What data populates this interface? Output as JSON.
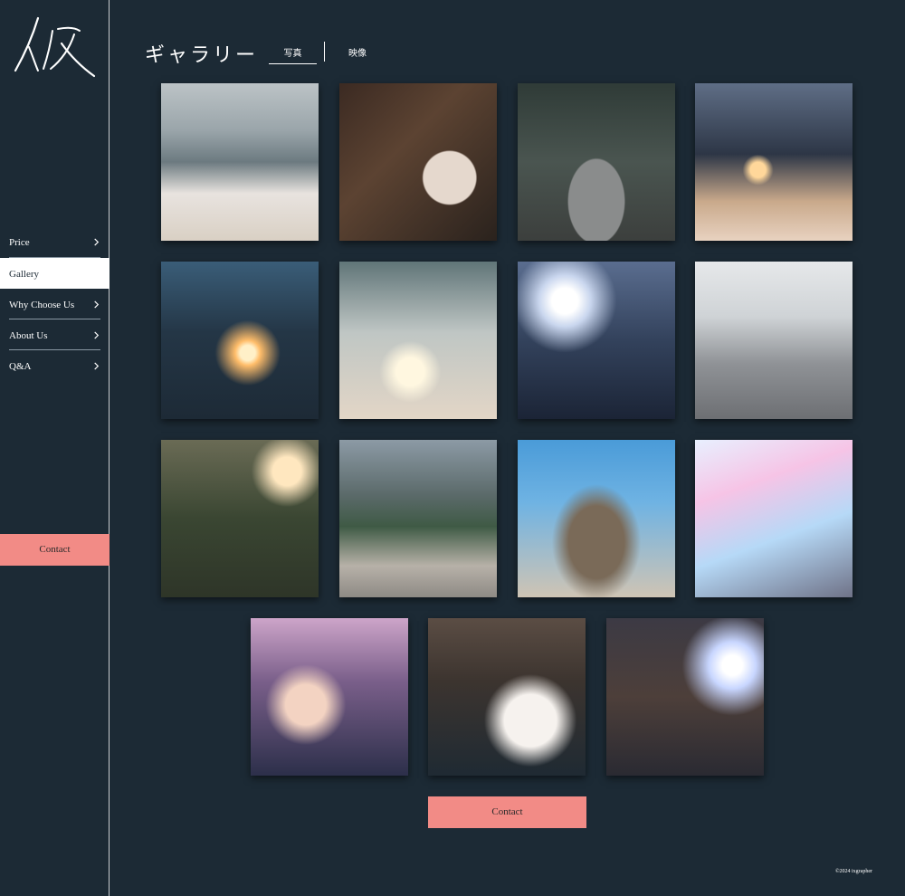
{
  "sidebar": {
    "logo_alt": "ixgrapher",
    "nav": [
      {
        "label": "Price",
        "has_chevron": true
      },
      {
        "label": "Gallery",
        "has_chevron": false,
        "active": true
      },
      {
        "label": "Why Choose Us",
        "has_chevron": true
      },
      {
        "label": "About Us",
        "has_chevron": true
      },
      {
        "label": "Q&A",
        "has_chevron": true
      }
    ],
    "contact_label": "Contact"
  },
  "header": {
    "title": "ギャラリー",
    "tabs": [
      {
        "label": "写真",
        "active": true
      },
      {
        "label": "映像",
        "active": false
      }
    ]
  },
  "gallery": {
    "photo_count": 15
  },
  "main": {
    "contact_label": "Contact"
  },
  "footer": {
    "copyright": "©2024 ixgrapher"
  },
  "colors": {
    "background": "#1c2a35",
    "accent": "#f28b86",
    "text": "#ffffff"
  }
}
